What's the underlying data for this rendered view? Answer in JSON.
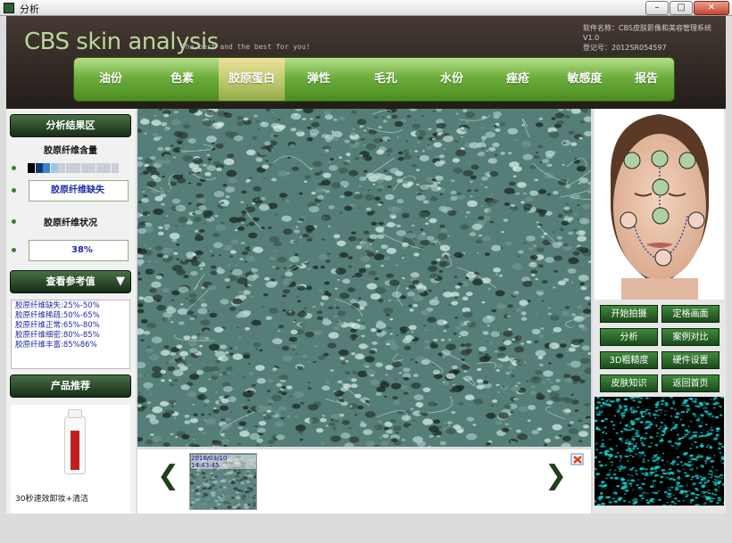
{
  "window": {
    "title": "分析",
    "buttons": [
      "–",
      "□",
      "✕"
    ]
  },
  "header": {
    "brand": "CBS skin analysis",
    "tagline": "The best and the best for you!",
    "software_name": "软件名称：CBS皮肤影像和美容管理系统V1.0",
    "register_no": "登记号：2012SR054597"
  },
  "nav": {
    "items": [
      "油份",
      "色素",
      "胶原蛋白",
      "弹性",
      "毛孔",
      "水份",
      "痤疮",
      "敏感度",
      "报告"
    ],
    "active": "胶原蛋白"
  },
  "left": {
    "results_title": "分析结果区",
    "content_label": "胶原纤维含量",
    "content_swatch_colors": [
      "#000000",
      "#0b3b7a",
      "#3a82c9",
      "#9dc8ea",
      "#c9cfd6",
      "#c9cfd6",
      "#c9cfd6",
      "#c9cfd6",
      "#c9cfd6",
      "#c9cfd6",
      "#c9cfd6",
      "#c9cfd6"
    ],
    "content_value": "胶原纤维缺失",
    "status_label": "胶原纤维状况",
    "status_value": "38%",
    "reference_title": "查看参考值",
    "reference_lines": [
      "胶原纤维缺失:25%-50%",
      "胶原纤维稀疏:50%-65%",
      "胶原纤维正常:65%-80%",
      "胶原纤维细密:80%-85%",
      "胶原纤维丰富:85%86%"
    ],
    "product_title": "产品推荐",
    "product_name": "30秒速效卸妆+清洁"
  },
  "thumbnail": {
    "timestamp": "2016/03/10 14:43:45",
    "prev": "❮",
    "next": "❯"
  },
  "right": {
    "buttons": [
      "开始拍摄",
      "定格画面",
      "分析",
      "案例对比",
      "3D粗糙度",
      "硬件设置",
      "皮肤知识",
      "返回首页"
    ]
  },
  "colors": {
    "nav_green": "#6cae3c",
    "active_tab": "#d8d58a",
    "dark_green": "#1b4a1b",
    "header_bg": "#2e2521"
  }
}
